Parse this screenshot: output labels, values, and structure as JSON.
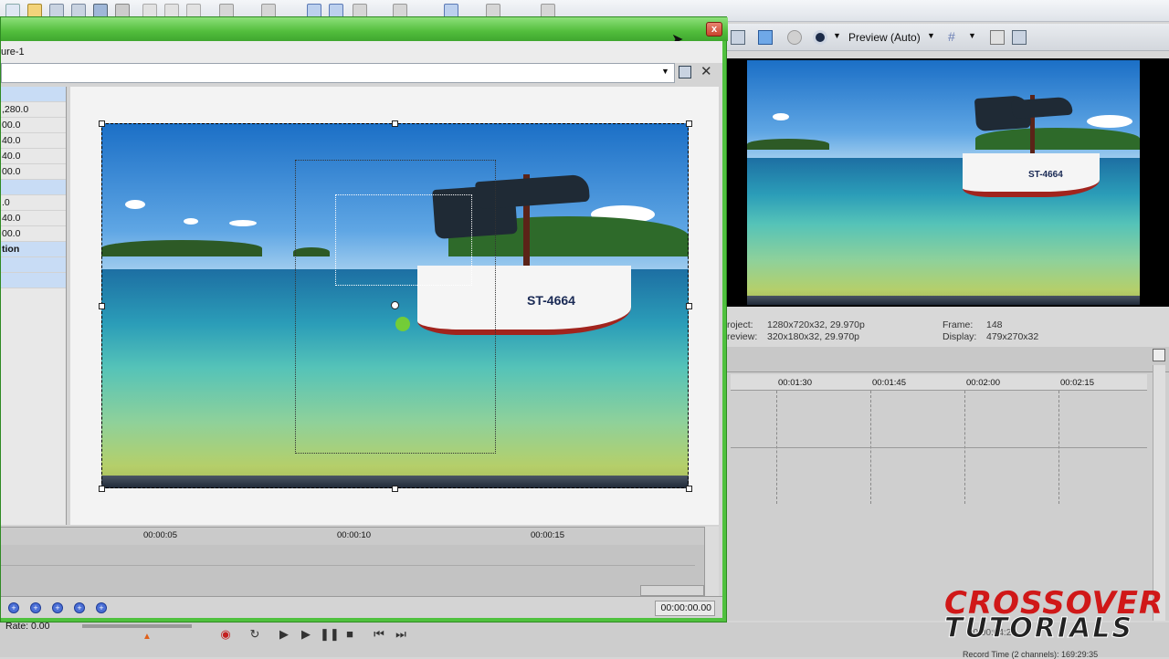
{
  "main_toolbar": {
    "icons": [
      "new-icon",
      "open-icon",
      "save-icon",
      "save-as-icon",
      "render-icon",
      "properties-icon",
      "cut-icon",
      "copy-icon",
      "paste-icon",
      "undo-icon",
      "redo-icon",
      "snap-icon",
      "envelope-icon",
      "normal-edit-icon",
      "envelope-edit-icon",
      "selection-icon",
      "zoom-icon",
      "pen-icon"
    ]
  },
  "dialog": {
    "title_partial": "ure-1",
    "close_label": "x",
    "preset_value": "",
    "properties": [
      {
        "label": "",
        "head": true
      },
      {
        "label": ",280.0"
      },
      {
        "label": "00.0"
      },
      {
        "label": "40.0"
      },
      {
        "label": "40.0"
      },
      {
        "label": "00.0"
      },
      {
        "label": "",
        "head": true
      },
      {
        "label": ".0"
      },
      {
        "label": "40.0"
      },
      {
        "label": "00.0"
      },
      {
        "label": "tion",
        "head": true
      },
      {
        "label": "",
        "head": true
      },
      {
        "label": "",
        "head": true
      }
    ],
    "boat_label": "ST-4664",
    "ruler": [
      "00:00:05",
      "00:00:10",
      "00:00:15"
    ],
    "timecode": "00:00:00.00"
  },
  "preview": {
    "mode": "Preview (Auto)",
    "boat_label": "ST-4664",
    "project_label": "roject:",
    "project_value": "1280x720x32, 29.970p",
    "preview_label": "review:",
    "preview_value": "320x180x32, 29.970p",
    "frame_label": "Frame:",
    "frame_value": "148",
    "display_label": "Display:",
    "display_value": "479x270x32"
  },
  "timeline": {
    "ruler": [
      "00:01:30",
      "00:01:45",
      "00:02:00",
      "00:02:15"
    ]
  },
  "transport": {
    "rate": "Rate: 0.00",
    "record_time": "Record Time (2 channels): 169:29:35",
    "time_partial": "00:00:04:28"
  },
  "watermark": {
    "line1": "CROSSOVER",
    "line2": "TUTORIALS"
  },
  "colors": {
    "dialog_frame": "#4fc13e",
    "sky": "#1b6fc6",
    "hull_stripe": "#a1241e",
    "keyframe": "#4b6fd6",
    "watermark_red": "#d01818"
  }
}
